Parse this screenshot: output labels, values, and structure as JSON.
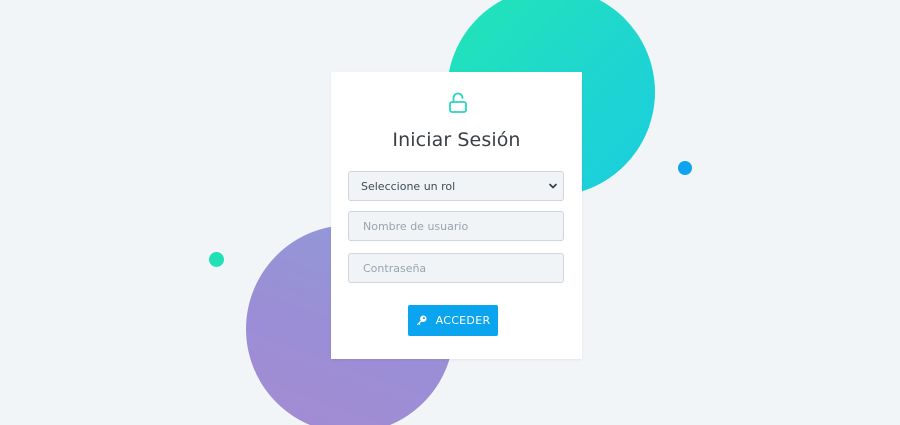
{
  "login": {
    "title": "Iniciar Sesión",
    "role_select": {
      "selected": "Seleccione un rol"
    },
    "username": {
      "placeholder": "Nombre de usuario"
    },
    "password": {
      "placeholder": "Contraseña"
    },
    "submit_label": "ACCEDER"
  },
  "icons": {
    "header": "lock-open-icon",
    "submit": "key-icon",
    "select_arrow": "chevron-down-icon"
  },
  "colors": {
    "background": "#f2f5f8",
    "accent": "#0ba5ef",
    "teal": "#22e6b4",
    "purple": "#9b8ed6"
  }
}
